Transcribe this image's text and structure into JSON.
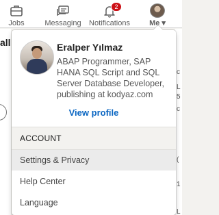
{
  "nav": {
    "jobs": {
      "label": "Jobs",
      "icon": "briefcase-icon"
    },
    "messaging": {
      "label": "Messaging",
      "icon": "chat-icon"
    },
    "notifications": {
      "label": "Notifications",
      "icon": "bell-icon",
      "badge": "2"
    },
    "me": {
      "label": "Me",
      "icon": "avatar"
    }
  },
  "background": {
    "fragment_left": "all",
    "fragments_right": [
      "c",
      "L",
      "5",
      "c",
      "(",
      "1",
      "L"
    ]
  },
  "profile": {
    "name": "Eralper Yılmaz",
    "headline": "ABAP Programmer, SAP HANA SQL Script and SQL Server Database Developer, publishing at kodyaz.com",
    "view_profile": "View profile"
  },
  "account": {
    "header": "ACCOUNT",
    "items": [
      "Settings & Privacy",
      "Help Center",
      "Language"
    ]
  },
  "colors": {
    "link": "#0a66c2",
    "badge": "#cc1016",
    "highlight": "#ebebeb"
  }
}
